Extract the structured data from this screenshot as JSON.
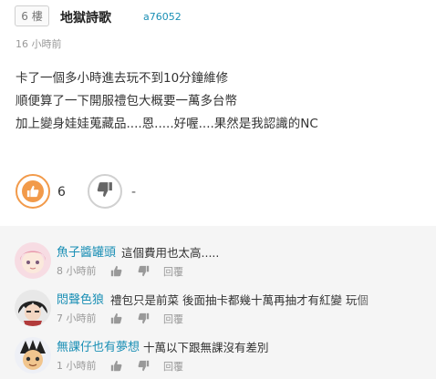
{
  "post": {
    "floor": "6 樓",
    "author_name": "地獄詩歌",
    "author_id": "a76052",
    "time": "16 小時前",
    "content_lines": [
      "卡了一個多小時進去玩不到10分鐘維修",
      "順便算了一下開服禮包大概要一萬多台幣",
      "加上變身娃娃蒐藏品....恩.....好喔....果然是我認識的NC"
    ],
    "like_count": "6",
    "dislike_count": "-",
    "colors": {
      "like_accent": "#f29a4a",
      "link_blue": "#1a8fb5"
    }
  },
  "replies": [
    {
      "name": "魚子醬罐頭",
      "text": "這個費用也太高.....",
      "time": "8 小時前",
      "reply_label": "回覆",
      "like_icon": "thumbs-up-icon",
      "dislike_icon": "thumbs-down-icon"
    },
    {
      "name": "悶聲色狼",
      "text": "禮包只是前菜 後面抽卡都幾十萬再抽才有紅變 玩個",
      "time": "7 小時前",
      "reply_label": "回覆",
      "like_icon": "thumbs-up-icon",
      "dislike_icon": "thumbs-down-icon"
    },
    {
      "name": "無課仔也有夢想",
      "text": "十萬以下跟無課沒有差別",
      "time": "1 小時前",
      "reply_label": "回覆",
      "like_icon": "thumbs-up-icon",
      "dislike_icon": "thumbs-down-icon"
    }
  ]
}
